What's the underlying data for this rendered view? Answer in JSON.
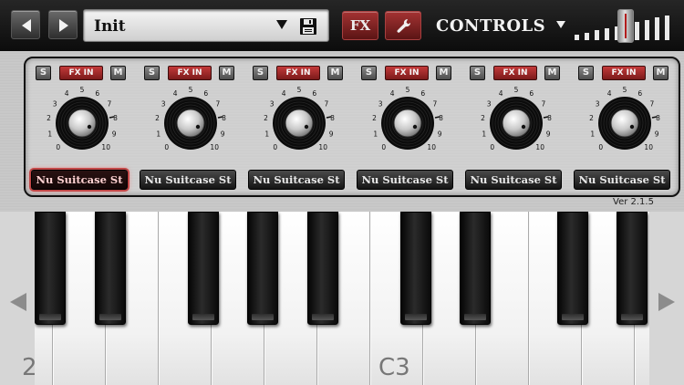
{
  "toolbar": {
    "preset_name": "Init",
    "fx_label": "FX",
    "controls_label": "CONTROLS",
    "meter_levels": [
      0.2,
      0.28,
      0.35,
      0.42,
      0.5,
      0.58,
      0.66,
      0.74,
      0.82,
      0.9
    ]
  },
  "panel": {
    "version": "Ver 2.1.5",
    "knob_scale": [
      "0",
      "1",
      "2",
      "3",
      "4",
      "5",
      "6",
      "7",
      "8",
      "9",
      "10"
    ],
    "channels": [
      {
        "solo": "S",
        "fx_in": "FX IN",
        "mute": "M",
        "instrument": "Nu Suitcase St",
        "selected": true
      },
      {
        "solo": "S",
        "fx_in": "FX IN",
        "mute": "M",
        "instrument": "Nu Suitcase St",
        "selected": false
      },
      {
        "solo": "S",
        "fx_in": "FX IN",
        "mute": "M",
        "instrument": "Nu Suitcase St",
        "selected": false
      },
      {
        "solo": "S",
        "fx_in": "FX IN",
        "mute": "M",
        "instrument": "Nu Suitcase St",
        "selected": false
      },
      {
        "solo": "S",
        "fx_in": "FX IN",
        "mute": "M",
        "instrument": "Nu Suitcase St",
        "selected": false
      },
      {
        "solo": "S",
        "fx_in": "FX IN",
        "mute": "M",
        "instrument": "Nu Suitcase St",
        "selected": false
      }
    ]
  },
  "keyboard": {
    "left_octave_label": "2",
    "c3_label": "C3",
    "colors": {
      "accent_red": "#a43232",
      "white_key": "#ffffff",
      "black_key": "#0a0a0a"
    }
  }
}
